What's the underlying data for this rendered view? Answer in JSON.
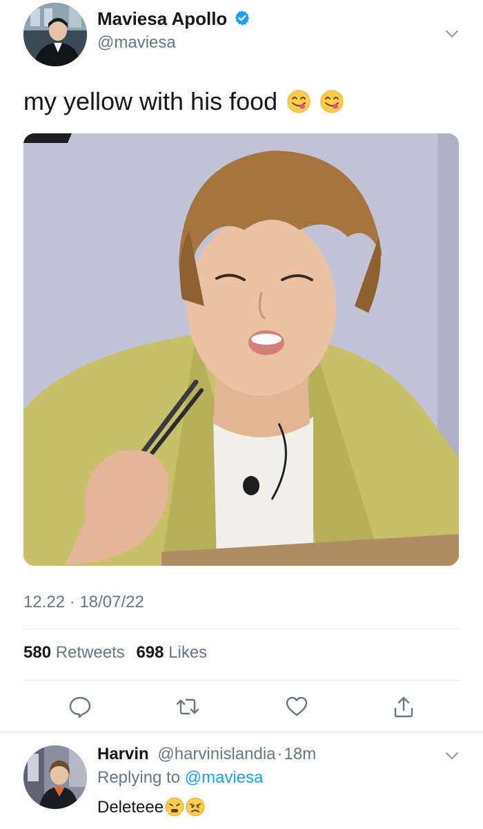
{
  "tweet": {
    "author": {
      "display_name": "Maviesa Apollo",
      "handle": "@maviesa",
      "verified": true
    },
    "text": "my yellow with his food",
    "text_emojis": [
      "face-savoring-food-emoji",
      "face-savoring-food-emoji"
    ],
    "timestamp": "12.22 · 18/07/22",
    "stats": {
      "retweets_count": "580",
      "retweets_label": "Retweets",
      "likes_count": "698",
      "likes_label": "Likes"
    },
    "actions": [
      "reply-icon",
      "retweet-icon",
      "like-icon",
      "share-icon"
    ]
  },
  "reply": {
    "display_name": "Harvin",
    "handle": "@harvinislandia",
    "separator": "·",
    "time": "18m",
    "replying_label": "Replying to",
    "replying_to": "@maviesa",
    "text": "Deleteee",
    "text_emojis": [
      "face-with-steam-emoji",
      "angry-face-emoji"
    ]
  },
  "colors": {
    "text_primary": "#14171a",
    "text_secondary": "#657786",
    "accent_blue": "#1da1f2",
    "divider": "#e1e8ed"
  }
}
